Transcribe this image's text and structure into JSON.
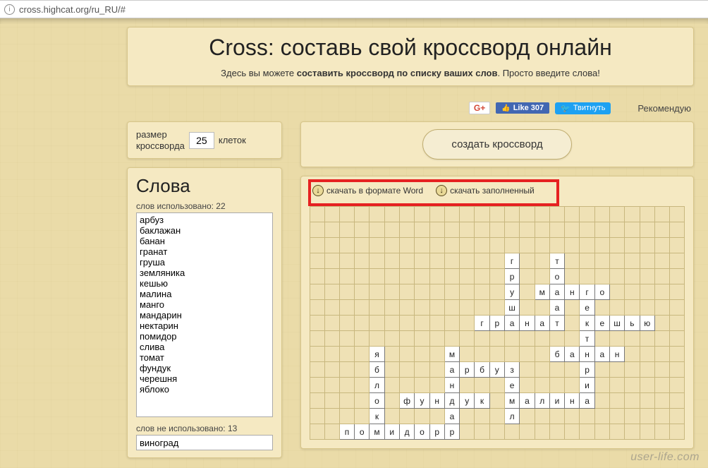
{
  "url": "cross.highcat.org/ru_RU/#",
  "hero": {
    "title": "Cross: составь свой кроссворд онлайн",
    "subtitle_prefix": "Здесь вы можете ",
    "subtitle_bold": "составить кроссворд по списку ваших слов",
    "subtitle_suffix": ". Просто введите слова!"
  },
  "social": {
    "gplus": "G+",
    "fb_like": "Like 307",
    "twitter": "Твитнуть",
    "recommended": "Рекомендую"
  },
  "size": {
    "label_line1": "размер",
    "label_line2": "кроссворда",
    "value": "25",
    "unit": "клеток"
  },
  "words": {
    "heading": "Слова",
    "used_label": "слов использовано: 22",
    "list": "арбуз\nбаклажан\nбанан\nгранат\nгруша\nземляника\nкешью\nмалина\nманго\nмандарин\nнектарин\nпомидор\nслива\nтомат\nфундук\nчерешня\nяблоко",
    "unused_label": "слов не использовано: 13",
    "unused_value": "виноград"
  },
  "actions": {
    "create": "создать кроссворд",
    "download_word": "скачать в формате Word",
    "download_filled": "скачать заполненный"
  },
  "grid": {
    "rows": 15,
    "cols": 25,
    "cells": [
      {
        "r": 4,
        "c": 14,
        "ch": "г"
      },
      {
        "r": 4,
        "c": 17,
        "ch": "т"
      },
      {
        "r": 5,
        "c": 14,
        "ch": "р"
      },
      {
        "r": 5,
        "c": 17,
        "ch": "о"
      },
      {
        "r": 6,
        "c": 14,
        "ch": "у"
      },
      {
        "r": 6,
        "c": 16,
        "ch": "м"
      },
      {
        "r": 6,
        "c": 17,
        "ch": "а"
      },
      {
        "r": 6,
        "c": 18,
        "ch": "н"
      },
      {
        "r": 6,
        "c": 19,
        "ch": "г"
      },
      {
        "r": 6,
        "c": 20,
        "ch": "о"
      },
      {
        "r": 7,
        "c": 14,
        "ch": "ш"
      },
      {
        "r": 7,
        "c": 17,
        "ch": "а"
      },
      {
        "r": 7,
        "c": 19,
        "ch": "е"
      },
      {
        "r": 8,
        "c": 12,
        "ch": "г"
      },
      {
        "r": 8,
        "c": 13,
        "ch": "р"
      },
      {
        "r": 8,
        "c": 14,
        "ch": "а"
      },
      {
        "r": 8,
        "c": 15,
        "ch": "н"
      },
      {
        "r": 8,
        "c": 16,
        "ch": "а"
      },
      {
        "r": 8,
        "c": 17,
        "ch": "т"
      },
      {
        "r": 8,
        "c": 19,
        "ch": "к"
      },
      {
        "r": 8,
        "c": 20,
        "ch": "е"
      },
      {
        "r": 8,
        "c": 21,
        "ch": "ш"
      },
      {
        "r": 8,
        "c": 22,
        "ch": "ь"
      },
      {
        "r": 8,
        "c": 23,
        "ch": "ю"
      },
      {
        "r": 9,
        "c": 19,
        "ch": "т"
      },
      {
        "r": 10,
        "c": 5,
        "ch": "я"
      },
      {
        "r": 10,
        "c": 10,
        "ch": "м"
      },
      {
        "r": 10,
        "c": 17,
        "ch": "б"
      },
      {
        "r": 10,
        "c": 18,
        "ch": "а"
      },
      {
        "r": 10,
        "c": 19,
        "ch": "н"
      },
      {
        "r": 10,
        "c": 20,
        "ch": "а"
      },
      {
        "r": 10,
        "c": 21,
        "ch": "н"
      },
      {
        "r": 11,
        "c": 5,
        "ch": "б"
      },
      {
        "r": 11,
        "c": 10,
        "ch": "а"
      },
      {
        "r": 11,
        "c": 11,
        "ch": "р"
      },
      {
        "r": 11,
        "c": 12,
        "ch": "б"
      },
      {
        "r": 11,
        "c": 13,
        "ch": "у"
      },
      {
        "r": 11,
        "c": 14,
        "ch": "з"
      },
      {
        "r": 11,
        "c": 19,
        "ch": "р"
      },
      {
        "r": 12,
        "c": 5,
        "ch": "л"
      },
      {
        "r": 12,
        "c": 10,
        "ch": "н"
      },
      {
        "r": 12,
        "c": 14,
        "ch": "е"
      },
      {
        "r": 12,
        "c": 19,
        "ch": "и"
      },
      {
        "r": 13,
        "c": 5,
        "ch": "о"
      },
      {
        "r": 13,
        "c": 7,
        "ch": "ф"
      },
      {
        "r": 13,
        "c": 8,
        "ch": "у"
      },
      {
        "r": 13,
        "c": 9,
        "ch": "н"
      },
      {
        "r": 13,
        "c": 10,
        "ch": "д"
      },
      {
        "r": 13,
        "c": 11,
        "ch": "у"
      },
      {
        "r": 13,
        "c": 12,
        "ch": "к"
      },
      {
        "r": 13,
        "c": 14,
        "ch": "м"
      },
      {
        "r": 13,
        "c": 15,
        "ch": "а"
      },
      {
        "r": 13,
        "c": 16,
        "ch": "л"
      },
      {
        "r": 13,
        "c": 17,
        "ch": "и"
      },
      {
        "r": 13,
        "c": 18,
        "ch": "н"
      },
      {
        "r": 13,
        "c": 19,
        "ch": "а"
      },
      {
        "r": 14,
        "c": 5,
        "ch": "к"
      },
      {
        "r": 14,
        "c": 10,
        "ch": "а"
      },
      {
        "r": 14,
        "c": 14,
        "ch": "л"
      },
      {
        "r": 15,
        "c": 3,
        "ch": "п"
      },
      {
        "r": 15,
        "c": 4,
        "ch": "о"
      },
      {
        "r": 15,
        "c": 5,
        "ch": "м"
      },
      {
        "r": 15,
        "c": 6,
        "ch": "и"
      },
      {
        "r": 15,
        "c": 7,
        "ch": "д"
      },
      {
        "r": 15,
        "c": 8,
        "ch": "о"
      },
      {
        "r": 15,
        "c": 9,
        "ch": "р"
      },
      {
        "r": 15,
        "c": 10,
        "ch": "р"
      }
    ]
  },
  "watermark": "user-life.com"
}
